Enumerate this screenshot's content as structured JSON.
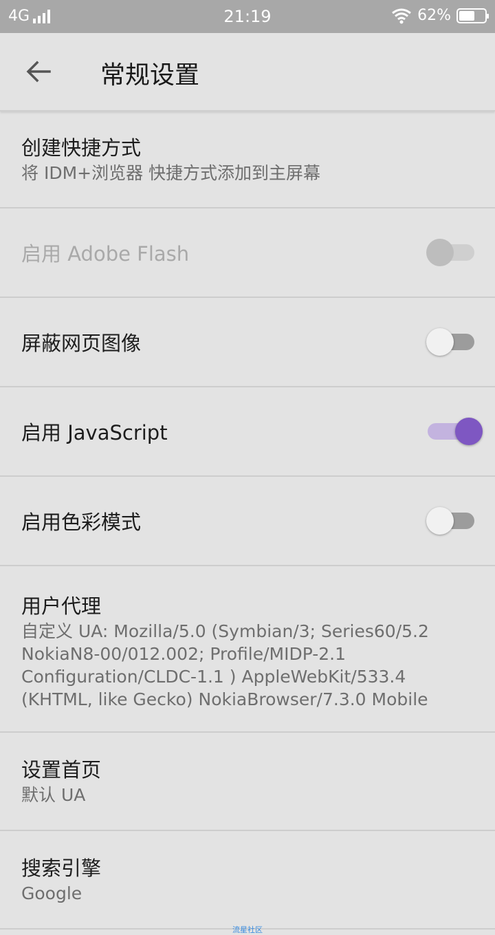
{
  "status_bar": {
    "network": "4G",
    "time": "21:19",
    "battery_percent": "62%",
    "battery_level": 0.62,
    "icons": [
      "signal-icon",
      "wifi-icon",
      "battery-icon"
    ]
  },
  "app_bar": {
    "back_icon": "arrow-left-icon",
    "title": "常规设置"
  },
  "settings": {
    "create_shortcut": {
      "title": "创建快捷方式",
      "summary": "将 IDM+浏览器 快捷方式添加到主屏幕"
    },
    "adobe_flash": {
      "title": "启用 Adobe Flash",
      "enabled": false,
      "checked": false
    },
    "block_images": {
      "title": "屏蔽网页图像",
      "checked": false
    },
    "javascript": {
      "title": "启用 JavaScript",
      "checked": true
    },
    "color_mode": {
      "title": "启用色彩模式",
      "checked": false
    },
    "user_agent": {
      "title": "用户代理",
      "summary": "自定义 UA: Mozilla/5.0 (Symbian/3; Series60/5.2 NokiaN8-00/012.002; Profile/MIDP-2.1 Configuration/CLDC-1.1 ) AppleWebKit/533.4 (KHTML, like Gecko) NokiaBrowser/7.3.0 Mobile"
    },
    "home_page": {
      "title": "设置首页",
      "summary": "默认 UA"
    },
    "search_engine": {
      "title": "搜索引擎",
      "summary": "Google"
    }
  },
  "watermark": "流星社区",
  "colors": {
    "accent": "#7e57c2",
    "background": "#e3e3e3",
    "status_bar": "#a8a8a8"
  }
}
